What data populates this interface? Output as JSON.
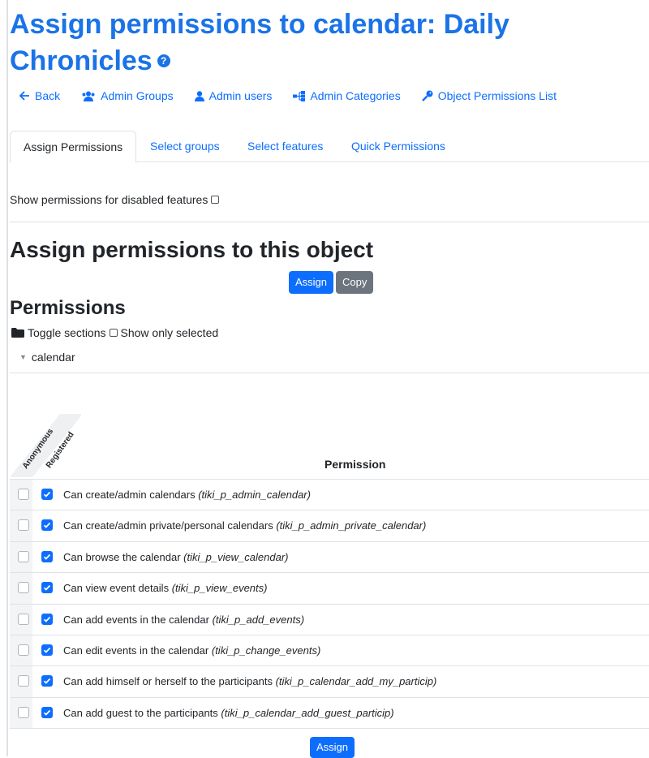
{
  "title": "Assign permissions to calendar: Daily Chronicles",
  "title_help_icon": "question-circle-icon",
  "nav": [
    {
      "label": "Back",
      "icon": "arrow-left-icon"
    },
    {
      "label": "Admin Groups",
      "icon": "users-icon"
    },
    {
      "label": "Admin users",
      "icon": "user-icon"
    },
    {
      "label": "Admin Categories",
      "icon": "sitemap-icon"
    },
    {
      "label": "Object Permissions List",
      "icon": "key-icon"
    }
  ],
  "tabs": [
    {
      "label": "Assign Permissions",
      "active": true
    },
    {
      "label": "Select groups",
      "active": false
    },
    {
      "label": "Select features",
      "active": false
    },
    {
      "label": "Quick Permissions",
      "active": false
    }
  ],
  "show_disabled_label": "Show permissions for disabled features",
  "show_disabled_checked": false,
  "assign_heading": "Assign permissions to this object",
  "assign_button": "Assign",
  "copy_button": "Copy",
  "permissions_heading": "Permissions",
  "toggle_sections_label": "Toggle sections",
  "show_only_selected_label": "Show only selected",
  "show_only_selected_checked": false,
  "section_name": "calendar",
  "columns": {
    "anonymous": "Anonymous",
    "registered": "Registered",
    "permission": "Permission"
  },
  "permissions": [
    {
      "label": "Can create/admin calendars",
      "code": "(tiki_p_admin_calendar)",
      "anonymous": false,
      "registered": true
    },
    {
      "label": "Can create/admin private/personal calendars",
      "code": "(tiki_p_admin_private_calendar)",
      "anonymous": false,
      "registered": true
    },
    {
      "label": "Can browse the calendar",
      "code": "(tiki_p_view_calendar)",
      "anonymous": false,
      "registered": true
    },
    {
      "label": "Can view event details",
      "code": "(tiki_p_view_events)",
      "anonymous": false,
      "registered": true
    },
    {
      "label": "Can add events in the calendar",
      "code": "(tiki_p_add_events)",
      "anonymous": false,
      "registered": true
    },
    {
      "label": "Can edit events in the calendar",
      "code": "(tiki_p_change_events)",
      "anonymous": false,
      "registered": true
    },
    {
      "label": "Can add himself or herself to the participants",
      "code": "(tiki_p_calendar_add_my_particip)",
      "anonymous": false,
      "registered": true
    },
    {
      "label": "Can add guest to the participants",
      "code": "(tiki_p_calendar_add_guest_particip)",
      "anonymous": false,
      "registered": true
    }
  ],
  "bottom_assign_button": "Assign",
  "colors": {
    "link": "#0d6efd",
    "title": "#1a73e8",
    "primary": "#0d6efd",
    "secondary": "#6c757d"
  }
}
